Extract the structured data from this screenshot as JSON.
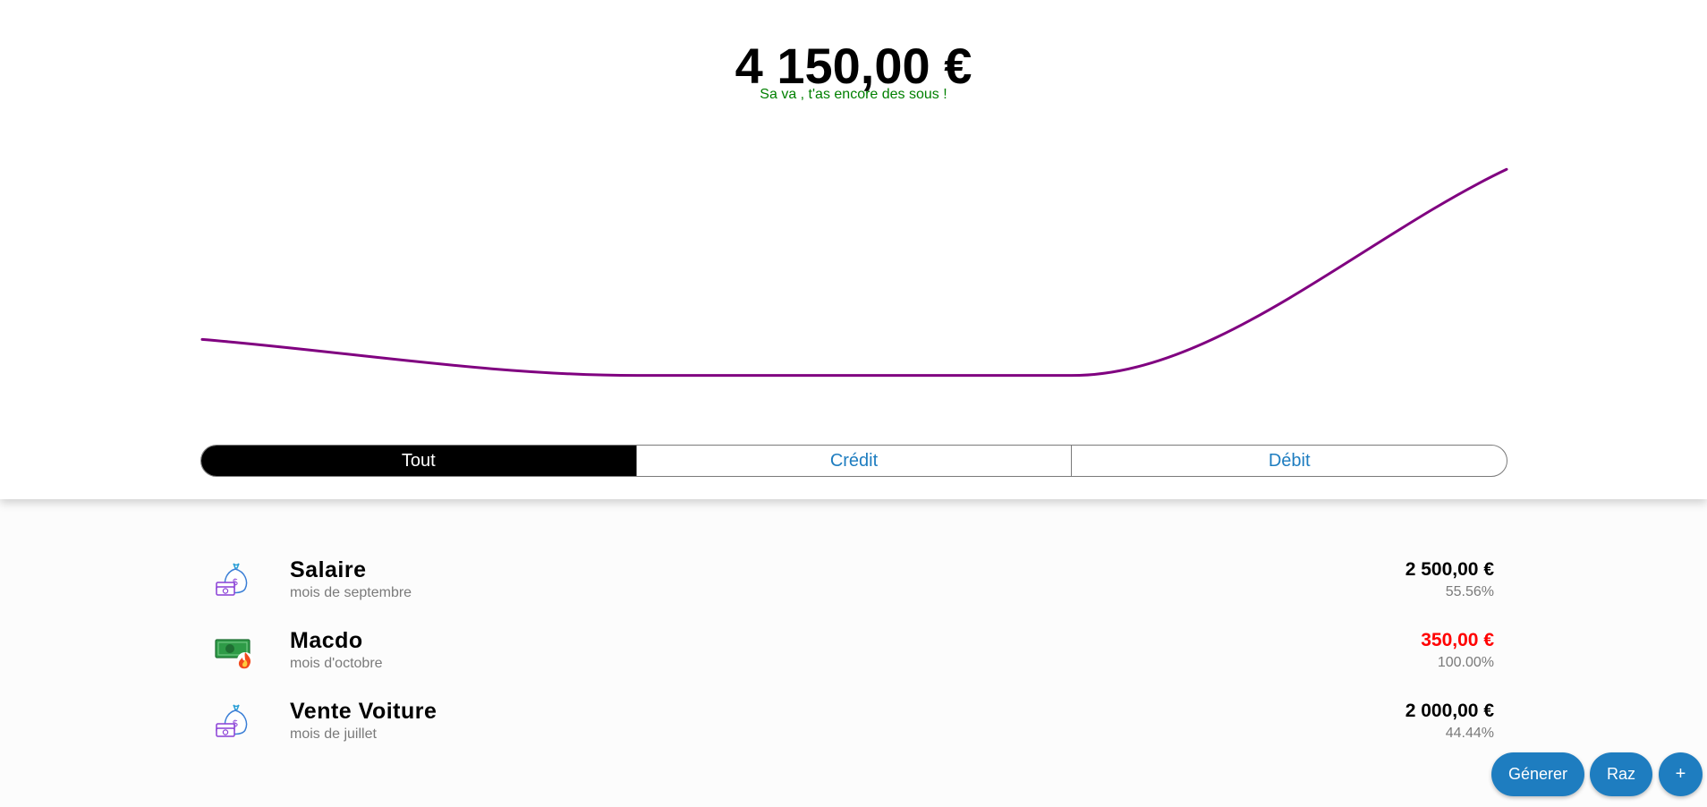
{
  "header": {
    "balance": "4 150,00 €",
    "message": "Sa va , t'as encore des sous !",
    "message_color": "#008000"
  },
  "chart_data": {
    "type": "line",
    "title": "",
    "xlabel": "",
    "ylabel": "",
    "grid": false,
    "line_color": "#800080",
    "x": [
      0,
      1,
      2,
      3
    ],
    "y": [
      2500,
      2150,
      2150,
      4150
    ]
  },
  "filters": {
    "active": "Tout",
    "tabs": [
      {
        "label": "Tout"
      },
      {
        "label": "Crédit"
      },
      {
        "label": "Débit"
      }
    ]
  },
  "transactions": [
    {
      "title": "Salaire",
      "period": "mois de septembre",
      "amount": "2 500,00 €",
      "percent": "55.56%",
      "type": "credit",
      "icon": "money-bag-icon"
    },
    {
      "title": "Macdo",
      "period": "mois d'octobre",
      "amount": "350,00 €",
      "percent": "100.00%",
      "type": "debit",
      "icon": "burning-cash-icon"
    },
    {
      "title": "Vente Voiture",
      "period": "mois de juillet",
      "amount": "2 000,00 €",
      "percent": "44.44%",
      "type": "credit",
      "icon": "money-bag-icon"
    }
  ],
  "actions": {
    "generate_label": "Génerer",
    "reset_label": "Raz",
    "add_label": "+"
  },
  "colors": {
    "accent": "#1e7dc0",
    "credit": "#000000",
    "debit": "#ff0000"
  }
}
